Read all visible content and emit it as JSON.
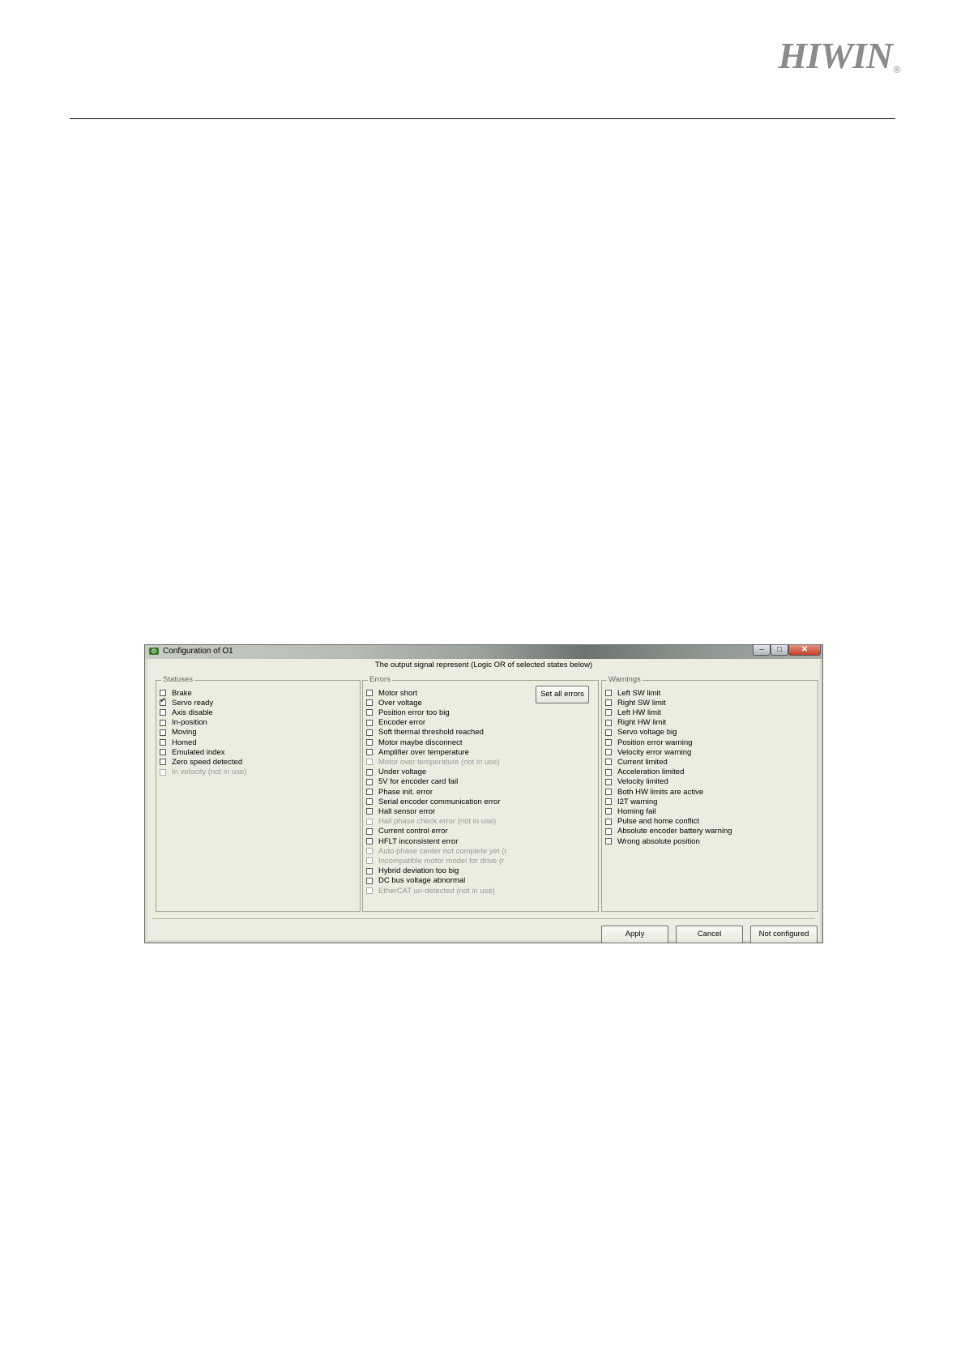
{
  "logo": {
    "text": "HIWIN",
    "reg": "®"
  },
  "dialog": {
    "title": "Configuration of O1",
    "header": "The output signal represent  (Logic OR of selected states below)",
    "window_controls": {
      "minimize": "–",
      "maximize": "□",
      "close": "✕"
    },
    "statuses": {
      "legend": "Statuses",
      "items": [
        {
          "label": "Brake",
          "checked": false,
          "disabled": false
        },
        {
          "label": "Servo ready",
          "checked": true,
          "disabled": false
        },
        {
          "label": "Axis disable",
          "checked": false,
          "disabled": false
        },
        {
          "label": "In-position",
          "checked": false,
          "disabled": false
        },
        {
          "label": "Moving",
          "checked": false,
          "disabled": false
        },
        {
          "label": "Homed",
          "checked": false,
          "disabled": false
        },
        {
          "label": "Emulated index",
          "checked": false,
          "disabled": false
        },
        {
          "label": "Zero speed detected",
          "checked": false,
          "disabled": false
        },
        {
          "label": "In velocity (not in use)",
          "checked": false,
          "disabled": true
        }
      ]
    },
    "errors": {
      "legend": "Errors",
      "set_all_label": "Set all errors",
      "items": [
        {
          "label": "Motor short",
          "checked": false,
          "disabled": false
        },
        {
          "label": "Over voltage",
          "checked": false,
          "disabled": false
        },
        {
          "label": "Position error too big",
          "checked": false,
          "disabled": false
        },
        {
          "label": "Encoder error",
          "checked": false,
          "disabled": false
        },
        {
          "label": "Soft thermal threshold reached",
          "checked": false,
          "disabled": false
        },
        {
          "label": "Motor maybe disconnect",
          "checked": false,
          "disabled": false
        },
        {
          "label": "Amplifier over temperature",
          "checked": false,
          "disabled": false
        },
        {
          "label": "Motor over temperature (not in use)",
          "checked": false,
          "disabled": true
        },
        {
          "label": "Under voltage",
          "checked": false,
          "disabled": false
        },
        {
          "label": "5V for encoder card fail",
          "checked": false,
          "disabled": false
        },
        {
          "label": "Phase init. error",
          "checked": false,
          "disabled": false
        },
        {
          "label": "Serial encoder communication error",
          "checked": false,
          "disabled": false
        },
        {
          "label": "Hall sensor error",
          "checked": false,
          "disabled": false
        },
        {
          "label": "Hall phase check error (not in use)",
          "checked": false,
          "disabled": true
        },
        {
          "label": "Current control error",
          "checked": false,
          "disabled": false
        },
        {
          "label": "HFLT inconsistent error",
          "checked": false,
          "disabled": false
        },
        {
          "label": "Auto phase center not complete yet (r",
          "checked": false,
          "disabled": true
        },
        {
          "label": "Incompatible motor model for drive (r",
          "checked": false,
          "disabled": true
        },
        {
          "label": "Hybrid deviation too big",
          "checked": false,
          "disabled": false
        },
        {
          "label": "DC bus voltage abnormal",
          "checked": false,
          "disabled": false
        },
        {
          "label": "EtherCAT un-detected (not in use)",
          "checked": false,
          "disabled": true
        }
      ]
    },
    "warnings": {
      "legend": "Warnings",
      "items": [
        {
          "label": "Left SW limit",
          "checked": false,
          "disabled": false
        },
        {
          "label": "Right SW limit",
          "checked": false,
          "disabled": false
        },
        {
          "label": "Left HW limit",
          "checked": false,
          "disabled": false
        },
        {
          "label": "Right HW limit",
          "checked": false,
          "disabled": false
        },
        {
          "label": "Servo voltage big",
          "checked": false,
          "disabled": false
        },
        {
          "label": "Position error warning",
          "checked": false,
          "disabled": false
        },
        {
          "label": "Velocity error warning",
          "checked": false,
          "disabled": false
        },
        {
          "label": "Current limited",
          "checked": false,
          "disabled": false
        },
        {
          "label": "Acceleration limited",
          "checked": false,
          "disabled": false
        },
        {
          "label": "Velocity limited",
          "checked": false,
          "disabled": false
        },
        {
          "label": "Both HW limits are active",
          "checked": false,
          "disabled": false
        },
        {
          "label": "I2T warning",
          "checked": false,
          "disabled": false
        },
        {
          "label": "Homing fail",
          "checked": false,
          "disabled": false
        },
        {
          "label": "Pulse and home conflict",
          "checked": false,
          "disabled": false
        },
        {
          "label": "Absolute encoder battery warning",
          "checked": false,
          "disabled": false
        },
        {
          "label": "Wrong absolute position",
          "checked": false,
          "disabled": false
        }
      ]
    },
    "buttons": {
      "apply": "Apply",
      "cancel": "Cancel",
      "not_configured": "Not configured"
    }
  }
}
